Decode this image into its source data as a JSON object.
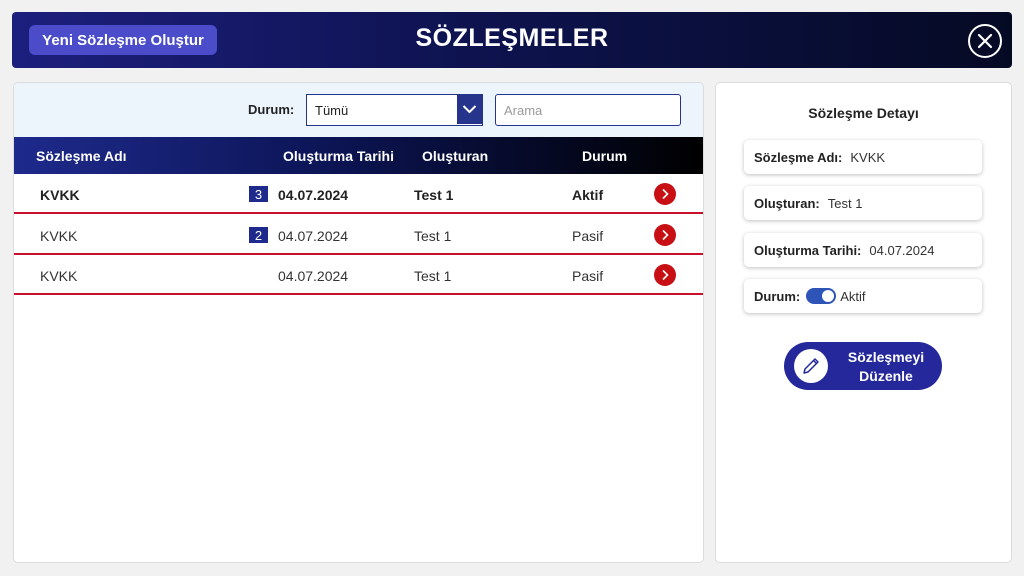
{
  "header": {
    "new_button": "Yeni Sözleşme Oluştur",
    "title": "SÖZLEŞMELER",
    "close_icon": "close-circle-icon"
  },
  "filter": {
    "durum_label": "Durum:",
    "durum_value": "Tümü",
    "search_placeholder": "Arama"
  },
  "table": {
    "columns": [
      "Sözleşme Adı",
      "Oluşturma Tarihi",
      "Oluşturan",
      "Durum"
    ],
    "rows": [
      {
        "name": "KVKK",
        "badge": "3",
        "date": "04.07.2024",
        "creator": "Test 1",
        "status": "Aktif",
        "selected": true
      },
      {
        "name": "KVKK",
        "badge": "2",
        "date": "04.07.2024",
        "creator": "Test 1",
        "status": "Pasif",
        "selected": false
      },
      {
        "name": "KVKK",
        "badge": "",
        "date": "04.07.2024",
        "creator": "Test 1",
        "status": "Pasif",
        "selected": false
      }
    ]
  },
  "detail": {
    "title": "Sözleşme Detayı",
    "name_label": "Sözleşme Adı:",
    "name_value": "KVKK",
    "creator_label": "Oluşturan:",
    "creator_value": "Test 1",
    "date_label": "Oluşturma Tarihi:",
    "date_value": "04.07.2024",
    "status_label": "Durum:",
    "status_value": "Aktif",
    "status_on": true,
    "edit_button_line1": "Sözleşmeyi",
    "edit_button_line2": "Düzenle"
  },
  "colors": {
    "accent": "#24289a",
    "row_divider": "#c8102e",
    "action_red": "#c80f14"
  }
}
